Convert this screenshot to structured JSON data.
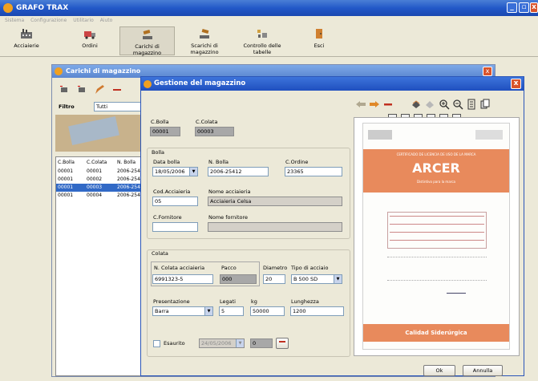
{
  "app": {
    "title": "GRAFO TRAX",
    "menu": [
      "Sistema",
      "Configurazione",
      "Utilitario",
      "Aiuto"
    ],
    "toolbar": [
      {
        "label": "Acciaierie",
        "icon": "factory-icon"
      },
      {
        "label": "Ordini",
        "icon": "truck-icon"
      },
      {
        "label": "Carichi di magazzino",
        "icon": "load-icon"
      },
      {
        "label": "Scarichi di magazzino",
        "icon": "unload-icon"
      },
      {
        "label": "Controllo delle tabelle",
        "icon": "tables-icon"
      },
      {
        "label": "Esci",
        "icon": "exit-door-icon"
      }
    ]
  },
  "carichi": {
    "title": "Carichi di magazzino",
    "filter_label": "Filtro",
    "filter_value": "Tutti",
    "columns": [
      "C.Bolla",
      "C.Colata",
      "N. Bolla"
    ],
    "rows": [
      {
        "bolla": "00001",
        "colata": "00001",
        "nbolla": "2006-254"
      },
      {
        "bolla": "00001",
        "colata": "00002",
        "nbolla": "2006-254"
      },
      {
        "bolla": "00001",
        "colata": "00003",
        "nbolla": "2006-254",
        "selected": true
      },
      {
        "bolla": "00001",
        "colata": "00004",
        "nbolla": "2006-254"
      }
    ]
  },
  "gestione": {
    "title": "Gestione del magazzino",
    "cbolla_label": "C.Bolla",
    "cbolla_value": "00001",
    "ccolata_label": "C.Colata",
    "ccolata_value": "00003",
    "bolla": {
      "group_label": "Bolla",
      "data_bolla_label": "Data bolla",
      "data_bolla_value": "18/05/2006",
      "n_bolla_label": "N. Bolla",
      "n_bolla_value": "2006-25412",
      "c_ordine_label": "C.Ordine",
      "c_ordine_value": "23365",
      "cod_acciaieria_label": "Cod.Acciaieria",
      "cod_acciaieria_value": "05",
      "nome_acciaieria_label": "Nome acciaieria",
      "nome_acciaieria_value": "Acciaieria Celsa",
      "c_fornitore_label": "C.Fornitore",
      "c_fornitore_value": "",
      "nome_fornitore_label": "Nome fornitore",
      "nome_fornitore_value": ""
    },
    "colata": {
      "group_label": "Colata",
      "n_colata_label": "N. Colata acciaieria",
      "n_colata_value": "6991323-5",
      "pacco_label": "Pacco",
      "pacco_value": "000",
      "diametro_label": "Diametro",
      "diametro_value": "20",
      "tipo_acciaio_label": "Tipo di acciaio",
      "tipo_acciaio_value": "B 500 SD",
      "presentazione_label": "Presentazione",
      "presentazione_value": "Barra",
      "legati_label": "Legati",
      "legati_value": "5",
      "kg_label": "kg",
      "kg_value": "50000",
      "lunghezza_label": "Lunghezza",
      "lunghezza_value": "1200",
      "esaurito_label": "Esaurito",
      "esaurito_date": "24/05/2006",
      "esaurito_num": "0"
    },
    "ok_label": "Ok",
    "annulla_label": "Annulla"
  },
  "document": {
    "header": "CERTIFICADO DE LICENCIA DE USO DE LA MARCA",
    "brand": "ARCER",
    "brand_sub": "Distintivo para la marca",
    "footer": "Calidad Siderúrgica"
  },
  "colors": {
    "title_blue": "#2258c8",
    "selection": "#3169c6",
    "doc_orange": "#e88a5c"
  }
}
